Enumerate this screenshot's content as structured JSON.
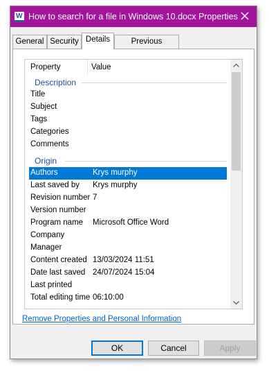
{
  "window": {
    "title": "How to search for a file in Windows 10.docx Properties",
    "app_icon": "word-document-icon",
    "accent_color": "#a4139e",
    "selection_color": "#0078d7"
  },
  "tabs": [
    {
      "label": "General"
    },
    {
      "label": "Security"
    },
    {
      "label": "Details",
      "active": true
    },
    {
      "label": "Previous Versions"
    }
  ],
  "details": {
    "columns": {
      "property": "Property",
      "value": "Value"
    },
    "groups": [
      {
        "label": "Description",
        "rows": [
          {
            "key": "Title",
            "value": ""
          },
          {
            "key": "Subject",
            "value": ""
          },
          {
            "key": "Tags",
            "value": ""
          },
          {
            "key": "Categories",
            "value": ""
          },
          {
            "key": "Comments",
            "value": ""
          }
        ]
      },
      {
        "label": "Origin",
        "rows": [
          {
            "key": "Authors",
            "value": "Krys murphy",
            "selected": true
          },
          {
            "key": "Last saved by",
            "value": "Krys murphy"
          },
          {
            "key": "Revision number",
            "value": "7"
          },
          {
            "key": "Version number",
            "value": ""
          },
          {
            "key": "Program name",
            "value": "Microsoft Office Word"
          },
          {
            "key": "Company",
            "value": ""
          },
          {
            "key": "Manager",
            "value": ""
          },
          {
            "key": "Content created",
            "value": "13/03/2024 11:51"
          },
          {
            "key": "Date last saved",
            "value": "24/07/2024 15:04"
          },
          {
            "key": "Last printed",
            "value": ""
          },
          {
            "key": "Total editing time",
            "value": "06:10:00"
          }
        ]
      }
    ]
  },
  "remove_link": "Remove Properties and Personal Information",
  "buttons": {
    "ok": "OK",
    "cancel": "Cancel",
    "apply": "Apply"
  }
}
